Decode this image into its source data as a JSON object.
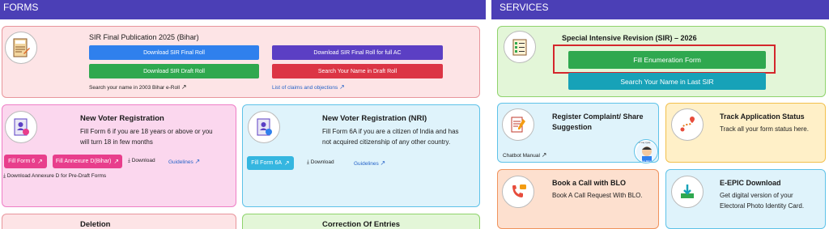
{
  "forms_header": "FORMS",
  "services_header": "SERVICES",
  "sir": {
    "title": "SIR Final Publication 2025 (Bihar)",
    "btn_final_roll": "Download SIR Final Roll",
    "btn_final_roll_ac": "Download SIR Final Roll for full AC",
    "btn_draft_roll": "Download SIR Draft Roll",
    "btn_search_draft": "Search Your Name in Draft Roll",
    "link_search_2003": "Search your name in 2003 Bihar e-Roll",
    "link_claims": "List of claims and objections",
    "icon_label": "SIR Form"
  },
  "new_voter": {
    "title": "New Voter Registration",
    "desc_line1": "Fill Form 6 if you are 18 years or above or you",
    "desc_line2": "will turn 18 in few months",
    "btn_form6": "Fill Form 6",
    "btn_annexure": "Fill Annexure D(Bihar)",
    "download": "Download",
    "guidelines": "Guidelines",
    "download_annexure": "Download Annexure D for Pre-Draft Forms"
  },
  "nri": {
    "title": "New Voter Registration (NRI)",
    "desc_line1": "Fill Form 6A if you are a citizen of India and has",
    "desc_line2": "not acquired citizenship of any other country.",
    "btn_form6a": "Fill Form 6A",
    "download": "Download",
    "guidelines": "Guidelines"
  },
  "deletion": {
    "title": "Deletion"
  },
  "correction": {
    "title": "Correction Of Entries"
  },
  "special": {
    "title": "Special Intensive Revision (SIR) – 2026",
    "btn_fill": "Fill Enumeration Form",
    "btn_search": "Search Your Name in Last SIR"
  },
  "complaint": {
    "title_line1": "Register Complaint/ Share",
    "title_line2": "Suggestion",
    "chatbot": "Chatbot Manual",
    "badge_top": "How may I help",
    "badge_bottom": "Voter Mitra"
  },
  "track": {
    "title": "Track Application Status",
    "desc": "Track all your form status here."
  },
  "blo": {
    "title": "Book a Call with BLO",
    "desc": "Book A Call Request With BLO."
  },
  "epic": {
    "title": "E-EPIC Download",
    "desc_line1": "Get digital version of your",
    "desc_line2": "Electoral Photo Identity Card."
  },
  "colors": {
    "header": "#4b3fb6",
    "blue_btn": "#2f80ed",
    "purple_btn": "#5b3fc4",
    "green_btn": "#2fa84f",
    "red_btn": "#dc3545",
    "pink_btn": "#e83e8c",
    "cyan_btn": "#35b6e0",
    "teal_btn": "#17a2b8",
    "highlight_box": "#d4272c"
  }
}
